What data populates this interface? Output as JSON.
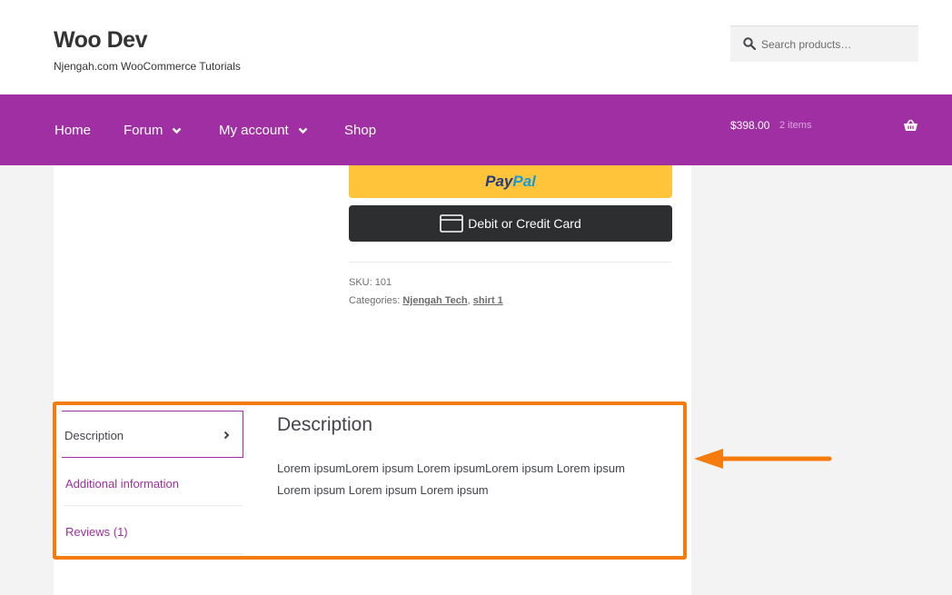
{
  "site": {
    "title": "Woo Dev",
    "tagline": "Njengah.com WooCommerce Tutorials"
  },
  "search": {
    "placeholder": "Search products…"
  },
  "nav": {
    "items": [
      {
        "label": "Home",
        "has_dropdown": false
      },
      {
        "label": "Forum",
        "has_dropdown": true
      },
      {
        "label": "My account",
        "has_dropdown": true
      },
      {
        "label": "Shop",
        "has_dropdown": false
      }
    ]
  },
  "cart": {
    "amount": "$398.00",
    "count": "2 items"
  },
  "payment": {
    "paypal_part1": "Pay",
    "paypal_part2": "Pal",
    "card_label": "Debit or Credit Card"
  },
  "product_meta": {
    "sku_label": "SKU:",
    "sku_value": "101",
    "categories_label": "Categories:",
    "categories": [
      "Njengah Tech",
      "shirt 1"
    ],
    "separator": ","
  },
  "tabs": {
    "items": [
      {
        "label": "Description",
        "active": true
      },
      {
        "label": "Additional information",
        "active": false
      },
      {
        "label": "Reviews (1)",
        "active": false
      }
    ]
  },
  "description": {
    "heading": "Description",
    "text": "Lorem ipsumLorem ipsum Lorem ipsumLorem ipsum Lorem ipsum Lorem ipsum Lorem ipsum Lorem ipsum"
  },
  "colors": {
    "brand": "#a02fa3",
    "highlight": "#f57c0c",
    "paypal_button": "#ffc439",
    "card_button": "#2c2e2f"
  }
}
